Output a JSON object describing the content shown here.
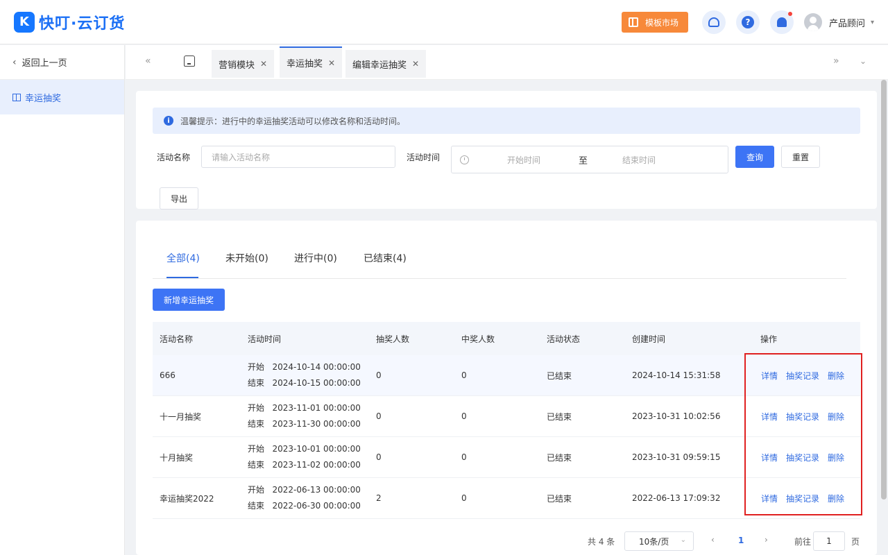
{
  "header": {
    "logo_mark": "K",
    "logo_text": "快叮·云订货",
    "market_label": "模板市场",
    "user_name": "产品顾问"
  },
  "sidebar": {
    "back_label": "返回上一页",
    "items": [
      {
        "label": "幸运抽奖",
        "icon": "gift-icon"
      }
    ]
  },
  "tabs": [
    {
      "label": "营销模块",
      "active": false
    },
    {
      "label": "幸运抽奖",
      "active": true
    },
    {
      "label": "编辑幸运抽奖",
      "active": false
    }
  ],
  "tip": "温馨提示：进行中的幸运抽奖活动可以修改名称和活动时间。",
  "filter": {
    "name_label": "活动名称",
    "name_placeholder": "请输入活动名称",
    "time_label": "活动时间",
    "start_placeholder": "开始时间",
    "range_sep": "至",
    "end_placeholder": "结束时间",
    "search_label": "查询",
    "reset_label": "重置",
    "export_label": "导出"
  },
  "status_tabs": [
    {
      "label": "全部(4)",
      "active": true
    },
    {
      "label": "未开始(0)",
      "active": false
    },
    {
      "label": "进行中(0)",
      "active": false
    },
    {
      "label": "已结束(4)",
      "active": false
    }
  ],
  "add_button": "新增幸运抽奖",
  "table": {
    "columns": [
      "活动名称",
      "活动时间",
      "抽奖人数",
      "中奖人数",
      "活动状态",
      "创建时间",
      "操作"
    ],
    "start_prefix": "开始",
    "end_prefix": "结束",
    "rows": [
      {
        "name": "666",
        "start": "2024-10-14 00:00:00",
        "end": "2024-10-15 00:00:00",
        "draws": "0",
        "winners": "0",
        "status": "已结束",
        "created": "2024-10-14 15:31:58"
      },
      {
        "name": "十一月抽奖",
        "start": "2023-11-01 00:00:00",
        "end": "2023-11-30 00:00:00",
        "draws": "0",
        "winners": "0",
        "status": "已结束",
        "created": "2023-10-31 10:02:56"
      },
      {
        "name": "十月抽奖",
        "start": "2023-10-01 00:00:00",
        "end": "2023-11-02 00:00:00",
        "draws": "0",
        "winners": "0",
        "status": "已结束",
        "created": "2023-10-31 09:59:15"
      },
      {
        "name": "幸运抽奖2022",
        "start": "2022-06-13 00:00:00",
        "end": "2022-06-30 00:00:00",
        "draws": "2",
        "winners": "0",
        "status": "已结束",
        "created": "2022-06-13 17:09:32"
      }
    ],
    "actions": [
      "详情",
      "抽奖记录",
      "删除"
    ]
  },
  "pagination": {
    "total": "共 4 条",
    "page_size": "10条/页",
    "current_page": "1",
    "goto_label": "前往",
    "goto_value": "1",
    "page_unit": "页"
  },
  "colors": {
    "primary": "#3d74f5",
    "accent_orange": "#f7893a",
    "highlight_box": "#e02020"
  }
}
